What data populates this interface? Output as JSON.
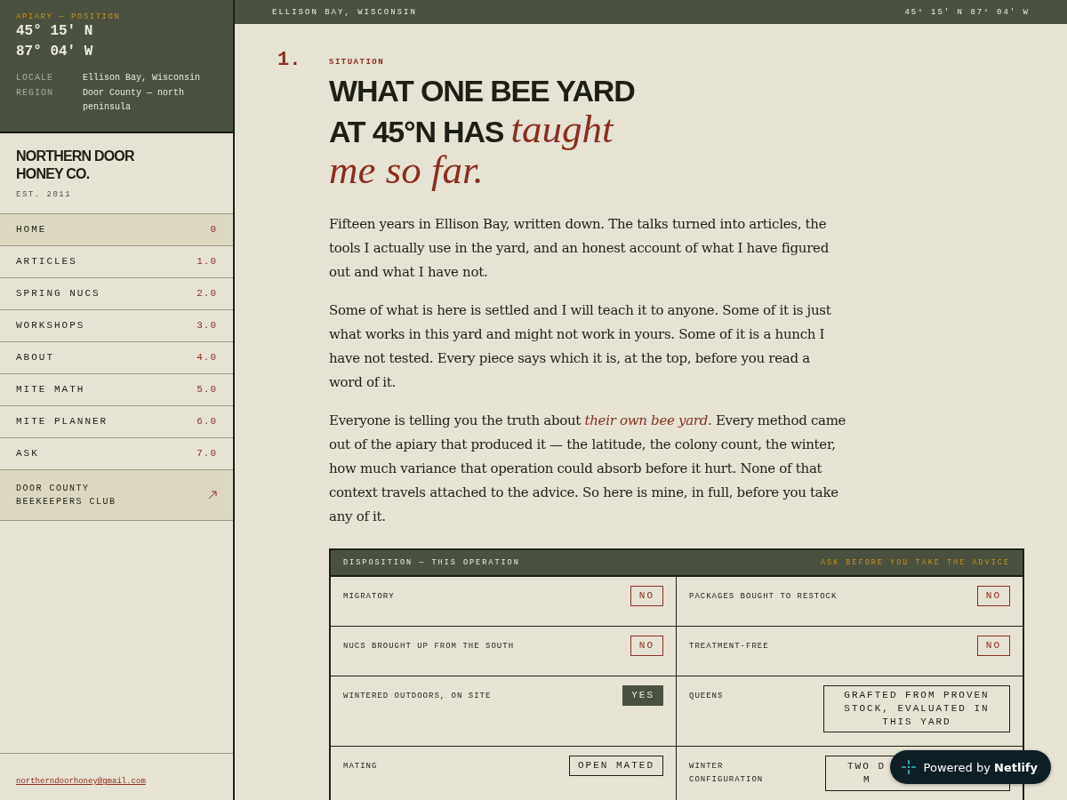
{
  "position": {
    "label": "APIARY — POSITION",
    "lat": "45° 15′ N",
    "lon": "87° 04′ W",
    "facts": [
      {
        "key": "LOCALE",
        "value": "Ellison Bay, Wisconsin"
      },
      {
        "key": "REGION",
        "value": "Door County — north peninsula"
      }
    ]
  },
  "brand": {
    "name": "NORTHERN DOOR HONEY CO.",
    "established": "EST. 2011"
  },
  "nav": [
    {
      "kind": "page",
      "label": "HOME",
      "number": "0",
      "selected": true
    },
    {
      "kind": "page",
      "label": "ARTICLES",
      "number": "1.0",
      "selected": false
    },
    {
      "kind": "page",
      "label": "SPRING NUCS",
      "number": "2.0",
      "selected": false
    },
    {
      "kind": "page",
      "label": "WORKSHOPS",
      "number": "3.0",
      "selected": false
    },
    {
      "kind": "page",
      "label": "ABOUT",
      "number": "4.0",
      "selected": false
    },
    {
      "kind": "page",
      "label": "MITE MATH",
      "number": "5.0",
      "selected": false
    },
    {
      "kind": "page",
      "label": "MITE PLANNER",
      "number": "6.0",
      "selected": false
    },
    {
      "kind": "page",
      "label": "ASK",
      "number": "7.0",
      "selected": false
    },
    {
      "kind": "external",
      "label": "DOOR COUNTY BEEKEEPERS CLUB"
    }
  ],
  "email": "northerndoorhoney@gmail.com",
  "top_bar": {
    "place": "ELLISON BAY, WISCONSIN",
    "coordinates": "45° 15′ N 87° 04′ W"
  },
  "section": {
    "number": "1.",
    "eyebrow": "SITUATION",
    "headline": "WHAT ONE BEE YARD AT 45°N HAS *taught me so far.*",
    "paragraphs": [
      "Fifteen years in Ellison Bay, written down. The talks turned into articles, the tools I actually use in the yard, and an honest account of what I have figured out and what I have not.",
      "Some of what is here is settled and I will teach it to anyone. Some of it is just what works in this yard and might not work in yours. Some of it is a hunch I have not tested. Every piece says which it is, at the top, before you read a word of it.",
      "Everyone is telling you the truth about *their own bee yard.* Every method came out of the apiary that produced it — the latitude, the colony count, the winter, how much variance that operation could absorb before it hurt. None of that context travels attached to the advice. So here is mine, in full, before you take any of it."
    ]
  },
  "disposition": {
    "title": "DISPOSITION — THIS OPERATION",
    "note": "ASK BEFORE YOU TAKE THE ADVICE",
    "cells": [
      {
        "label": "MIGRATORY",
        "kind": "no",
        "value": "NO"
      },
      {
        "label": "PACKAGES BOUGHT TO RESTOCK",
        "kind": "no",
        "value": "NO"
      },
      {
        "label": "NUCS BROUGHT UP FROM THE SOUTH",
        "kind": "no",
        "value": "NO"
      },
      {
        "label": "TREATMENT-FREE",
        "kind": "no",
        "value": "NO"
      },
      {
        "label": "WINTERED OUTDOORS, ON SITE",
        "kind": "yes",
        "value": "YES"
      },
      {
        "label": "QUEENS",
        "kind": "text",
        "value": "GRAFTED FROM PROVEN STOCK, EVALUATED IN THIS YARD"
      },
      {
        "label": "MATING",
        "kind": "text",
        "value": "OPEN MATED"
      },
      {
        "label": "WINTER CONFIGURATION",
        "kind": "covered",
        "value_lines": [
          "TWO D",
          "M"
        ]
      }
    ]
  },
  "badge": {
    "text": "Powered by **Netlify**"
  }
}
